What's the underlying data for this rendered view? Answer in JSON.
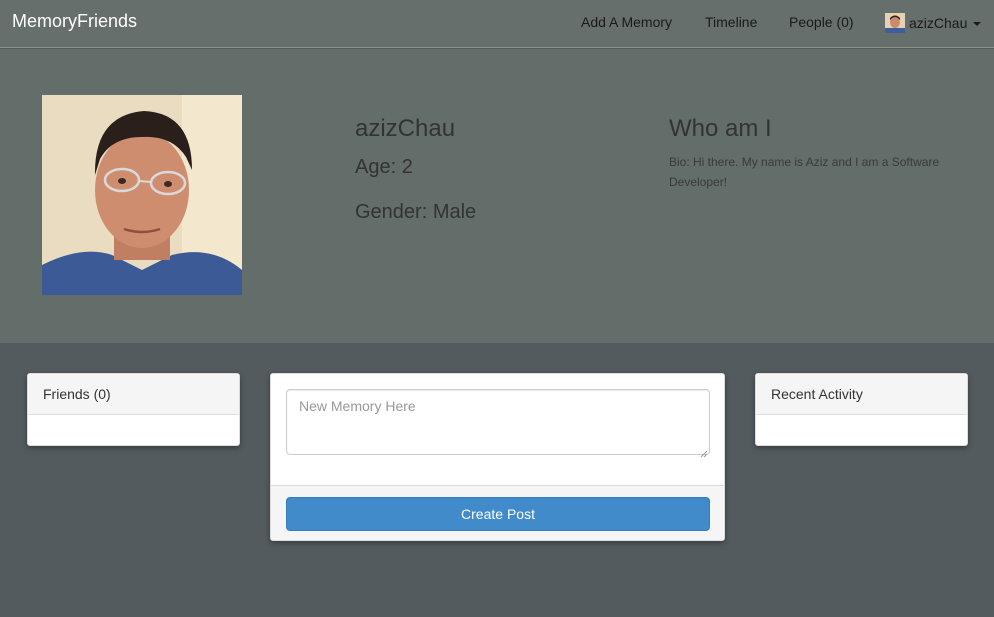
{
  "navbar": {
    "brand": "MemoryFriends",
    "add_memory": "Add A Memory",
    "timeline": "Timeline",
    "people": "People (0)",
    "username": "azizChau"
  },
  "profile": {
    "name": "azizChau",
    "age": "Age: 2",
    "gender": "Gender: Male",
    "who_heading": "Who am I",
    "bio": "Bio: Hi there. My name is Aziz and I am a Software Developer!"
  },
  "friends_panel": {
    "title": "Friends (0)"
  },
  "post_panel": {
    "placeholder": "New Memory Here",
    "button_label": "Create Post"
  },
  "activity_panel": {
    "title": "Recent Activity"
  },
  "colors": {
    "navbar_bg": "#666f6b",
    "profile_bg": "#636d69",
    "page_bg": "#535b5e",
    "button_bg": "#428bca"
  }
}
